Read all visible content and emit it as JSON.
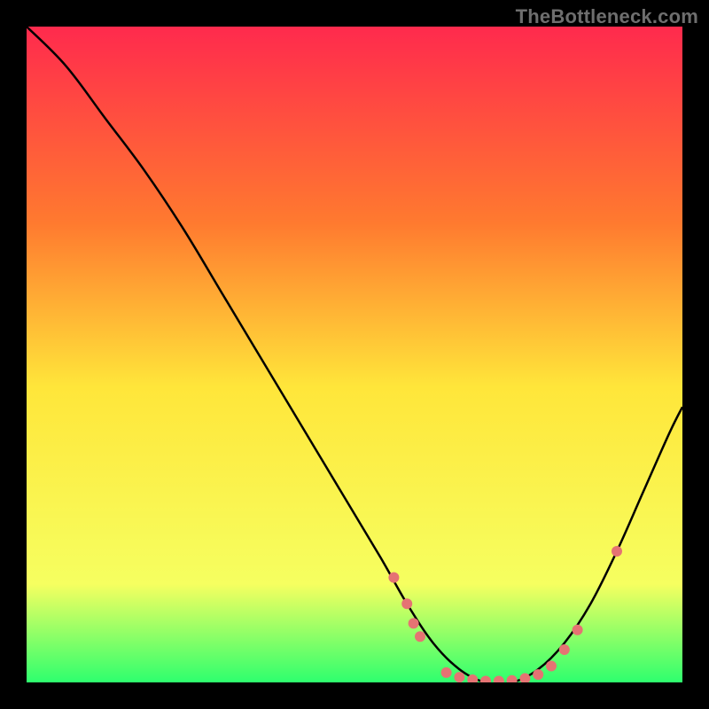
{
  "watermark": "TheBottleneck.com",
  "chart_data": {
    "type": "line",
    "title": "",
    "xlabel": "",
    "ylabel": "",
    "xlim": [
      0,
      100
    ],
    "ylim": [
      0,
      100
    ],
    "grid": false,
    "legend": false,
    "gradient_colors": {
      "top": "#ff2a4d",
      "mid_upper": "#ff7a2f",
      "mid": "#ffe63a",
      "mid_lower": "#f6ff60",
      "bottom": "#2eff6e"
    },
    "series": [
      {
        "name": "bottleneck-curve",
        "color": "#000000",
        "x": [
          0,
          6,
          12,
          18,
          24,
          30,
          36,
          42,
          48,
          54,
          58,
          62,
          66,
          70,
          74,
          78,
          82,
          86,
          90,
          94,
          98,
          100
        ],
        "y": [
          100,
          94,
          86,
          78,
          69,
          59,
          49,
          39,
          29,
          19,
          12,
          6,
          2,
          0,
          0,
          2,
          6,
          12,
          20,
          29,
          38,
          42
        ]
      }
    ],
    "markers": {
      "name": "highlight-dots",
      "color": "#e57373",
      "radius": 6,
      "points": [
        {
          "x": 56,
          "y": 16
        },
        {
          "x": 58,
          "y": 12
        },
        {
          "x": 59,
          "y": 9
        },
        {
          "x": 60,
          "y": 7
        },
        {
          "x": 64,
          "y": 1.5
        },
        {
          "x": 66,
          "y": 0.8
        },
        {
          "x": 68,
          "y": 0.4
        },
        {
          "x": 70,
          "y": 0.2
        },
        {
          "x": 72,
          "y": 0.2
        },
        {
          "x": 74,
          "y": 0.3
        },
        {
          "x": 76,
          "y": 0.6
        },
        {
          "x": 78,
          "y": 1.2
        },
        {
          "x": 80,
          "y": 2.5
        },
        {
          "x": 82,
          "y": 5
        },
        {
          "x": 84,
          "y": 8
        },
        {
          "x": 90,
          "y": 20
        }
      ]
    }
  }
}
